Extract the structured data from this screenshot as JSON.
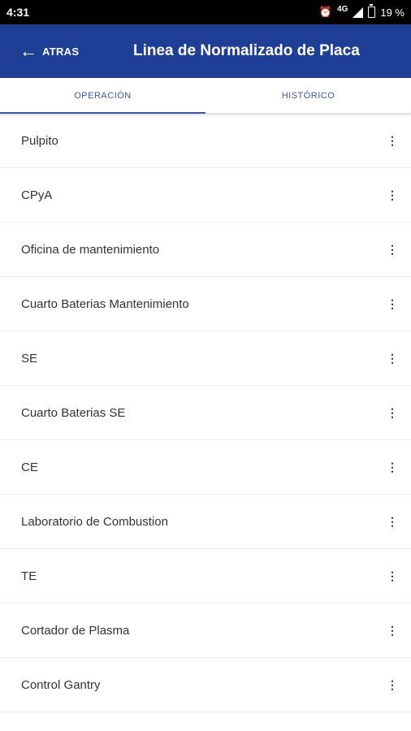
{
  "status": {
    "time": "4:31",
    "network": "4G",
    "battery": "19 %"
  },
  "appbar": {
    "back_label": "ATRAS",
    "title": "Linea de Normalizado de Placa"
  },
  "tabs": [
    {
      "label": "OPERACIÓN"
    },
    {
      "label": "HISTÓRICO"
    }
  ],
  "items": [
    {
      "label": "Pulpito"
    },
    {
      "label": "CPyA"
    },
    {
      "label": "Oficina de mantenimiento"
    },
    {
      "label": "Cuarto Baterias Mantenimiento"
    },
    {
      "label": "SE"
    },
    {
      "label": "Cuarto Baterias SE"
    },
    {
      "label": "CE"
    },
    {
      "label": "Laboratorio de Combustion"
    },
    {
      "label": "TE"
    },
    {
      "label": "Cortador de Plasma"
    },
    {
      "label": "Control Gantry"
    }
  ]
}
